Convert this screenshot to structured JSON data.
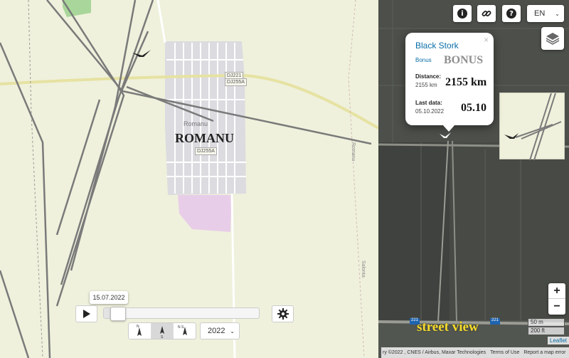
{
  "map": {
    "town_label_small": "Romanu",
    "town_label_large": "ROMANU",
    "road_shield_1": "DJ221",
    "road_shield_2": "DJ255A",
    "road_shield_3": "DJ255A",
    "vertical_label_1": "Romanu",
    "vertical_label_2": "Salonta"
  },
  "toolbar": {
    "info_icon": "info-icon",
    "link_icon": "link-icon",
    "help_icon": "help-icon",
    "language": "EN"
  },
  "popup": {
    "title": "Black Stork",
    "subtitle": "Bonus",
    "bonus_text": "BONUS",
    "distance_label": "Distance:",
    "distance_value": "2155 km",
    "distance_big": "2155 km",
    "last_data_label": "Last data:",
    "last_data_value": "05.10.2022",
    "last_data_big": "05.10",
    "close": "×"
  },
  "satellite": {
    "road_badge_1": "221",
    "road_badge_2": "221",
    "street_view": "street view"
  },
  "zoom": {
    "in": "+",
    "out": "−"
  },
  "scale": {
    "metric": "50 m",
    "imperial": "200 ft"
  },
  "leaflet": "Leaflet",
  "attribution": {
    "imagery": "ry ©2022 , CNES / Airbus, Maxar Technologies",
    "terms": "Terms of Use",
    "report": "Report a map error"
  },
  "controls": {
    "date_tooltip": "15.07.2022",
    "timeline_progress": 0.04,
    "year": "2022",
    "orient_1": "N",
    "orient_2": "S",
    "orient_3": "N S"
  }
}
